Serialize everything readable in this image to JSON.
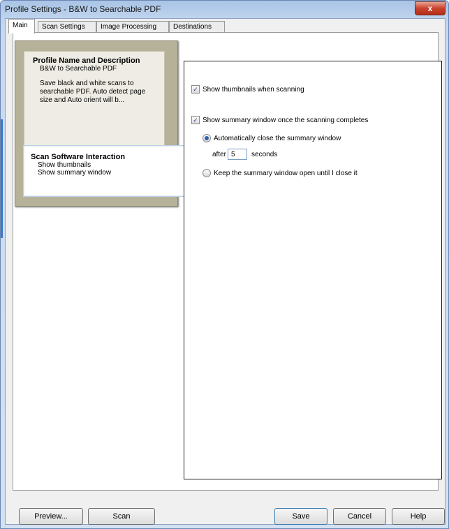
{
  "window": {
    "title": "Profile Settings - B&W to Searchable PDF",
    "close_glyph": "x"
  },
  "tabs": [
    {
      "label": "Main",
      "active": true
    },
    {
      "label": "Scan Settings",
      "active": false
    },
    {
      "label": "Image Processing",
      "active": false
    },
    {
      "label": "Destinations",
      "active": false
    }
  ],
  "nav": {
    "profile": {
      "title": "Profile Name and Description",
      "name": "B&W to Searchable PDF",
      "description": "Save black and white scans to searchable PDF. Auto detect page size and Auto orient will b..."
    },
    "interaction": {
      "title": "Scan Software Interaction",
      "line1": "Show thumbnails",
      "line2": "Show summary window"
    }
  },
  "options": {
    "show_thumbnails": {
      "label": "Show thumbnails when scanning",
      "checked": true
    },
    "show_summary": {
      "label": "Show summary window once the scanning completes",
      "checked": true
    },
    "auto_close": {
      "label": "Automatically close the summary window",
      "selected": true
    },
    "after_label": "after",
    "seconds_value": "5",
    "seconds_label": "seconds",
    "keep_open": {
      "label": "Keep the summary window open until I close it",
      "selected": false
    }
  },
  "buttons": {
    "preview": "Preview...",
    "scan": "Scan",
    "save": "Save",
    "cancel": "Cancel",
    "help": "Help"
  },
  "colors": {
    "accent": "#2f5fb3",
    "close": "#c8422c"
  }
}
